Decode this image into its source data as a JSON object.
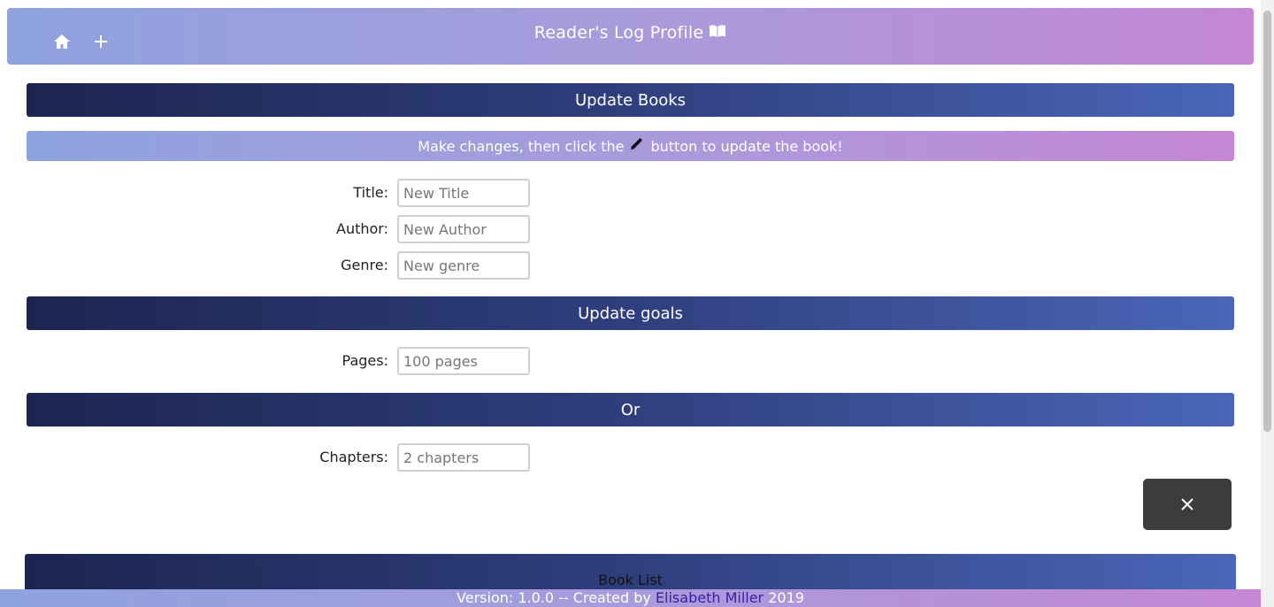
{
  "navbar": {
    "home_icon": "home-icon",
    "add_icon": "plus-icon",
    "title": "Reader's Log Profile",
    "title_icon": "open-book-icon"
  },
  "sections": {
    "update_books": "Update Books",
    "update_goals": "Update goals",
    "or": "Or"
  },
  "hint": {
    "prefix": "Make changes, then click the",
    "icon": "pencil-icon",
    "suffix": "button to update the book!"
  },
  "form": {
    "title_label": "Title:",
    "title_placeholder": "New Title",
    "author_label": "Author:",
    "author_placeholder": "New Author",
    "genre_label": "Genre:",
    "genre_placeholder": "New genre",
    "pages_label": "Pages:",
    "pages_placeholder": "100 pages",
    "chapters_label": "Chapters:",
    "chapters_placeholder": "2 chapters"
  },
  "close_button": {
    "icon": "close-icon"
  },
  "book_list": {
    "title": "Book List"
  },
  "footer": {
    "prefix": "Version: 1.0.0 -- Created by",
    "author": "Elisabeth Miller",
    "year": "2019"
  },
  "colors": {
    "gradient_light_start": "#8ea3de",
    "gradient_light_end": "#c587d4",
    "gradient_dark_start": "#1c2550",
    "gradient_dark_end": "#4a66b8",
    "close_button_bg": "#3c3c3c",
    "footer_link": "#3b1fa0"
  }
}
